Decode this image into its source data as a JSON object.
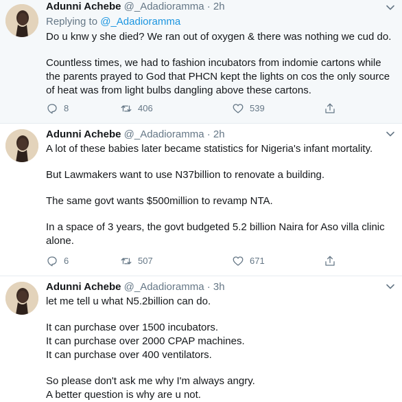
{
  "tweets": [
    {
      "name": "Adunni Achebe",
      "handle": "@_Adadioramma",
      "sep": "·",
      "time": "2h",
      "replying_prefix": "Replying to",
      "replying_handle": "@_Adadioramma",
      "paragraphs": [
        "Do u knw y she died? We ran out of oxygen & there was nothing we cud do.",
        "Countless times, we had to fashion incubators from indomie cartons while the parents prayed to God that PHCN kept the lights on cos the only source of heat was from light bulbs dangling above these cartons."
      ],
      "replies": "8",
      "retweets": "406",
      "likes": "539"
    },
    {
      "name": "Adunni Achebe",
      "handle": "@_Adadioramma",
      "sep": "·",
      "time": "2h",
      "paragraphs": [
        "A lot of these babies later became statistics for Nigeria's infant mortality.",
        "But Lawmakers want to use N37billion to renovate a building.",
        "The same govt wants $500million to revamp NTA.",
        "In a space of 3 years, the govt budgeted 5.2 billion Naira for Aso villa clinic alone."
      ],
      "replies": "6",
      "retweets": "507",
      "likes": "671"
    },
    {
      "name": "Adunni Achebe",
      "handle": "@_Adadioramma",
      "sep": "·",
      "time": "3h",
      "lines": [
        "let me tell u what N5.2billion can do.",
        "",
        "It can purchase over 1500 incubators.",
        "It can purchase over 2000 CPAP machines.",
        "It can purchase over 400 ventilators.",
        "",
        "So please don't ask me why I'm always angry.",
        "A better question is why are u not."
      ]
    }
  ],
  "icons": {
    "reply": "reply-icon",
    "retweet": "retweet-icon",
    "like": "heart-icon",
    "share": "share-icon",
    "caret": "chevron-down-icon"
  },
  "colors": {
    "name": "#14171a",
    "meta": "#657786",
    "link": "#1b95e0",
    "icon": "#657786",
    "highlight_bg": "#f5f8fa"
  }
}
